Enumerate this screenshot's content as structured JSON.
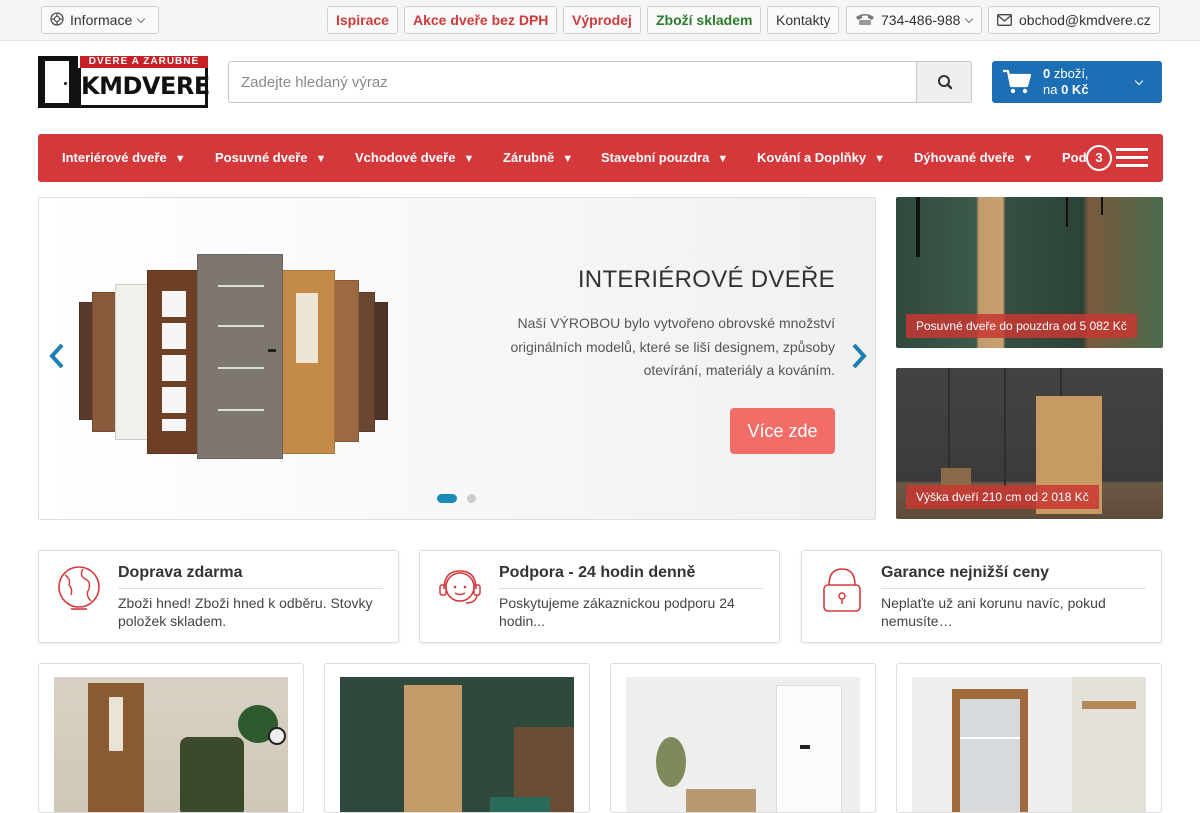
{
  "topbar": {
    "info_label": "Informace",
    "links": [
      "Ispirace",
      "Akce dveře bez DPH",
      "Výprodej",
      "Zboží skladem",
      "Kontakty"
    ],
    "phone": "734-486-988",
    "email": "obchod@kmdvere.cz"
  },
  "logo": {
    "tagline": "DVERE A ZÁRUBNĚ",
    "brand": "KMDVERE"
  },
  "search": {
    "placeholder": "Zadejte hledaný výraz"
  },
  "cart": {
    "count": "0",
    "count_suffix": "zboží,",
    "price_prefix": "na",
    "price": "0 Kč"
  },
  "nav": {
    "items": [
      "Interiérové dveře",
      "Posuvné dveře",
      "Vchodové dveře",
      "Zárubně",
      "Stavební pouzdra",
      "Kování a Doplňky",
      "Dýhované dveře",
      "Pod"
    ],
    "arrow": "▼",
    "badge": "3"
  },
  "hero": {
    "title": "INTERIÉROVÉ DVEŘE",
    "text": "Naší VÝROBOU bylo vytvořeno obrovské množství originálních modelů, které se liší designem, způsoby otevírání, materiály a kováním.",
    "button": "Více zde",
    "slide_count": 2,
    "active_slide": 1
  },
  "promos": [
    {
      "caption": "Posuvné dveře do pouzdra od 5 082 Kč"
    },
    {
      "caption": "Výška dveří 210 cm od 2 018 Kč"
    }
  ],
  "info_boxes": [
    {
      "title": "Doprava zdarma",
      "text": "Zboži hned! Zboži hned k odběru. Stovky položek skladem.",
      "icon": "globe-icon"
    },
    {
      "title": "Podpora - 24 hodin denně",
      "text": "Poskytujeme zákaznickou podporu 24 hodin...",
      "icon": "support-agent-icon"
    },
    {
      "title": "Garance nejnižší ceny",
      "text": "Neplaťte už ani korunu navíc, pokud nemusíte…",
      "icon": "lock-icon"
    }
  ],
  "colors": {
    "nav_red": "#d5383b",
    "cart_blue": "#1c6eb5",
    "hero_button": "#f26d67",
    "accent_red": "#d03a3a",
    "accent_green": "#2c7a2c"
  }
}
